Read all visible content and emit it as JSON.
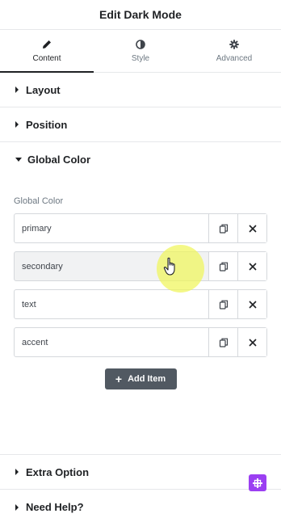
{
  "header": {
    "title": "Edit Dark Mode"
  },
  "tabs": [
    {
      "label": "Content",
      "icon": "pencil-icon",
      "active": true
    },
    {
      "label": "Style",
      "icon": "half-circle-icon",
      "active": false
    },
    {
      "label": "Advanced",
      "icon": "gear-icon",
      "active": false
    }
  ],
  "sections": {
    "layout": "Layout",
    "position": "Position",
    "global_color": "Global Color",
    "extra_option": "Extra Option",
    "need_help": "Need Help?"
  },
  "global_color": {
    "field_label": "Global Color",
    "items": [
      {
        "name": "primary"
      },
      {
        "name": "secondary"
      },
      {
        "name": "text"
      },
      {
        "name": "accent"
      }
    ],
    "add_label": "Add Item"
  },
  "colors": {
    "accent": "#9b3ff2",
    "button": "#515962"
  }
}
